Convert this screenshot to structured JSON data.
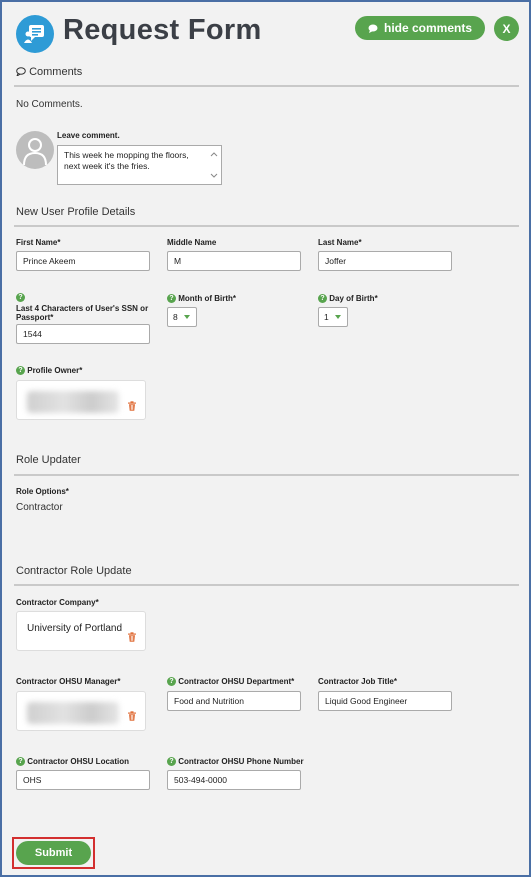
{
  "header": {
    "title": "Request Form",
    "hide_comments_label": "hide comments",
    "close_label": "X"
  },
  "comments": {
    "section_title": "Comments",
    "empty_text": "No Comments.",
    "leave_comment_label": "Leave comment.",
    "comment_text": "This week he mopping the floors, next week it's the fries."
  },
  "profile": {
    "section_title": "New User Profile Details",
    "first_name_label": "First Name*",
    "first_name_value": "Prince Akeem",
    "middle_name_label": "Middle Name",
    "middle_name_value": "M",
    "last_name_label": "Last Name*",
    "last_name_value": "Joffer",
    "ssn_label": "Last 4 Characters of User's SSN or Passport*",
    "ssn_value": "1544",
    "month_label": "Month of Birth*",
    "month_value": "8",
    "day_label": "Day of Birth*",
    "day_value": "1",
    "owner_label": "Profile Owner*"
  },
  "role": {
    "section_title": "Role Updater",
    "options_label": "Role Options*",
    "options_value": "Contractor"
  },
  "contractor": {
    "section_title": "Contractor Role Update",
    "company_label": "Contractor Company*",
    "company_value": "University of Portland",
    "manager_label": "Contractor OHSU Manager*",
    "department_label": "Contractor OHSU Department*",
    "department_value": "Food and Nutrition",
    "job_title_label": "Contractor Job Title*",
    "job_title_value": "Liquid Good Engineer",
    "location_label": "Contractor OHSU Location",
    "location_value": "OHS",
    "phone_label": "Contractor OHSU Phone Number",
    "phone_value": "503-494-0000"
  },
  "footer": {
    "submit_label": "Submit"
  },
  "colors": {
    "accent_green": "#58a44e",
    "logo_blue": "#2e9bd6",
    "highlight_red": "#d32f2f",
    "frame_blue": "#4a6fa5"
  },
  "icons": [
    "chat-form-icon",
    "comment-bubble-icon",
    "help-icon",
    "trash-icon",
    "avatar-icon",
    "chevron-down-icon"
  ]
}
